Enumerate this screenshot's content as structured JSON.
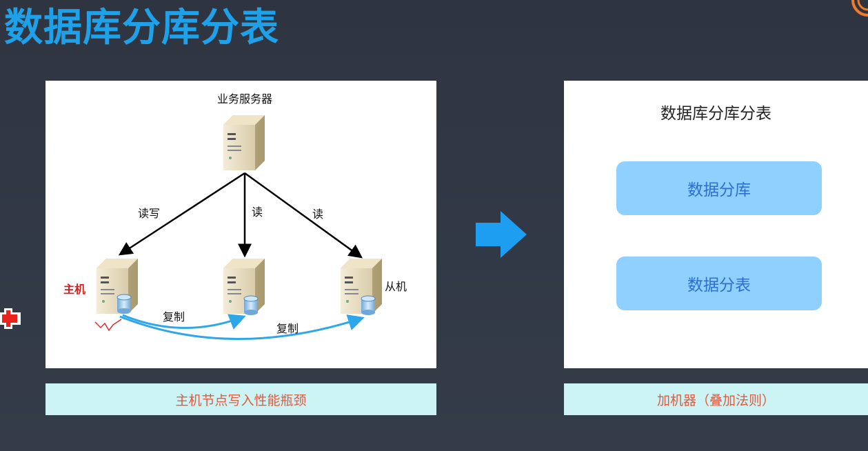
{
  "page": {
    "title": "数据库分库分表"
  },
  "left_diagram": {
    "server_label": "业务服务器",
    "edge_labels": {
      "read_write": "读写",
      "read_1": "读",
      "read_2": "读"
    },
    "master_label": "主机",
    "slave_label": "从机",
    "replicate_1": "复制",
    "replicate_2": "复制",
    "caption": "主机节点写入性能瓶颈"
  },
  "right_panel": {
    "title": "数据库分库分表",
    "boxes": [
      "数据分库",
      "数据分表"
    ],
    "caption": "加机器（叠加法则）"
  },
  "colors": {
    "title": "#1fa1ea",
    "arrow": "#1e9ef0",
    "box_fill": "#8fd0ff",
    "box_text": "#2c6fd0",
    "caption_bg": "#cdf4f5",
    "caption_text": "#e05a3f",
    "master_label": "#d02020",
    "replication_line": "#2ea6ea"
  },
  "icons": [
    "server-icon",
    "database-icon",
    "right-arrow-icon"
  ]
}
